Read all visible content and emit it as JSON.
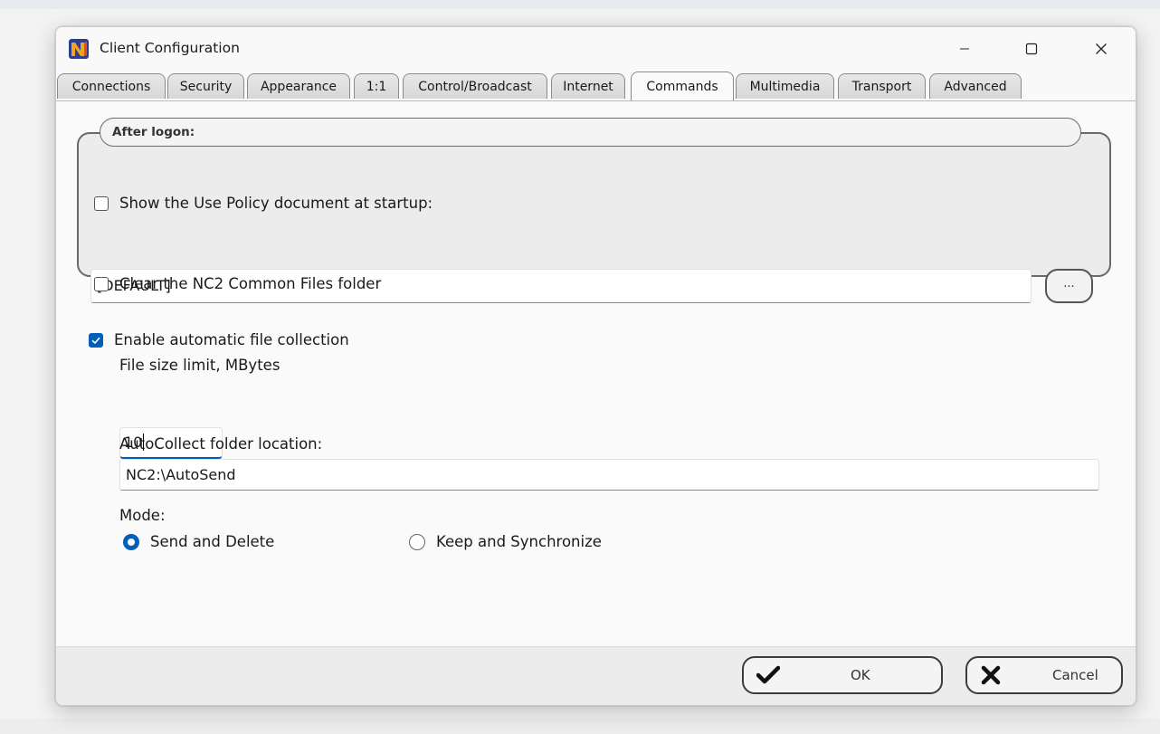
{
  "window": {
    "title": "Client Configuration"
  },
  "tabs": [
    {
      "label": "Connections",
      "active": false
    },
    {
      "label": "Security",
      "active": false
    },
    {
      "label": "Appearance",
      "active": false
    },
    {
      "label": "1:1",
      "active": false
    },
    {
      "label": "Control/Broadcast",
      "active": false
    },
    {
      "label": "Internet",
      "active": false
    },
    {
      "label": "Commands",
      "active": true
    },
    {
      "label": "Multimedia",
      "active": false
    },
    {
      "label": "Transport",
      "active": false
    },
    {
      "label": "Advanced",
      "active": false
    }
  ],
  "after_logon": {
    "title": "After logon:",
    "show_policy": {
      "label": "Show the Use Policy document at startup:",
      "checked": false
    },
    "policy_path": {
      "value": "[DEFAULT]"
    },
    "browse_label": "...",
    "clear_common": {
      "label": "Clear the NC2 Common Files folder",
      "checked": false
    }
  },
  "auto_collect": {
    "enable": {
      "label": "Enable automatic file collection",
      "checked": true
    },
    "size_limit": {
      "label": "File size limit, MBytes",
      "value": "10"
    },
    "folder": {
      "label": "AutoCollect folder location:",
      "value": "NC2:\\AutoSend"
    },
    "mode": {
      "label": "Mode:",
      "options": [
        {
          "label": "Send and Delete",
          "selected": true
        },
        {
          "label": "Keep and Synchronize",
          "selected": false
        }
      ]
    }
  },
  "footer": {
    "ok_label": "OK",
    "cancel_label": "Cancel"
  },
  "icons": {
    "app": "app-logo-icon",
    "minimize": "minimize-icon",
    "maximize": "maximize-icon",
    "close": "close-icon",
    "ok": "checkmark-icon",
    "cancel": "x-icon"
  },
  "colors": {
    "accent": "#005fb8"
  }
}
